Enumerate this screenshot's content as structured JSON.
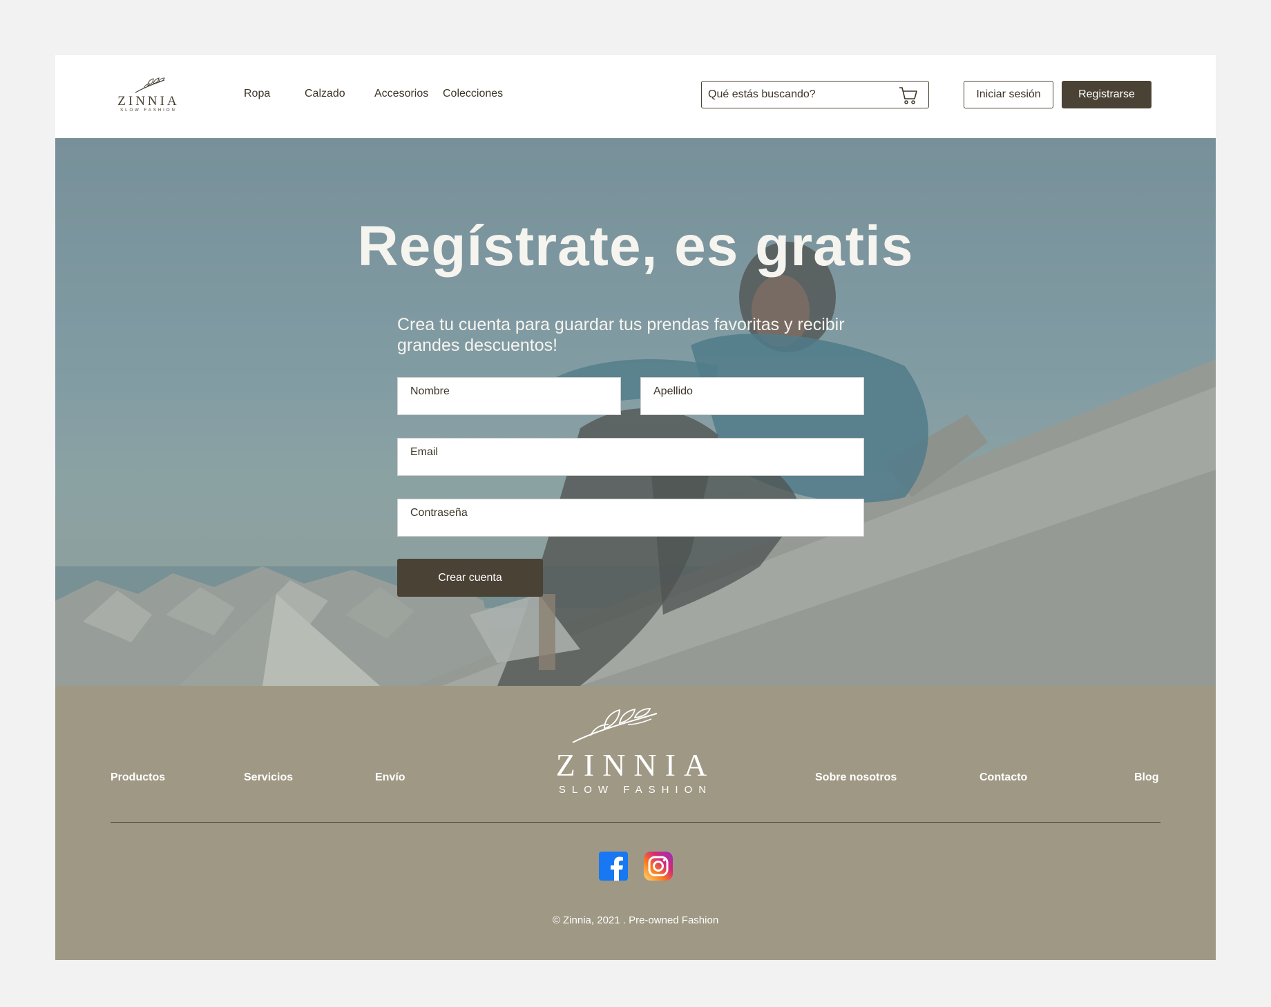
{
  "brand": {
    "name": "ZINNIA",
    "tagline": "SLOW FASHION"
  },
  "nav": {
    "items": [
      "Ropa",
      "Calzado",
      "Accesorios",
      "Colecciones"
    ]
  },
  "search": {
    "placeholder": "Qué estás buscando?",
    "icon": "cart-icon"
  },
  "header_buttons": {
    "login_label": "Iniciar sesión",
    "register_label": "Registrarse"
  },
  "hero": {
    "title": "Regístrate, es gratis",
    "subtitle": "Crea tu cuenta para guardar tus prendas favoritas y recibir grandes descuentos!",
    "fields": {
      "first_name_placeholder": "Nombre",
      "last_name_placeholder": "Apellido",
      "email_placeholder": "Email",
      "password_placeholder": "Contraseña"
    },
    "submit_label": "Crear cuenta"
  },
  "footer": {
    "left_links": [
      "Productos",
      "Servicios",
      "Envío"
    ],
    "right_links": [
      "Sobre nosotros",
      "Contacto",
      "Blog"
    ],
    "social": [
      "facebook-icon",
      "instagram-icon"
    ],
    "copyright": "©  Zinnia, 2021 . Pre-owned Fashion"
  },
  "colors": {
    "primary": "#4a4235",
    "footer_bg": "#9f9884",
    "page_bg": "#f2f2f2",
    "facebook": "#1877f2"
  }
}
